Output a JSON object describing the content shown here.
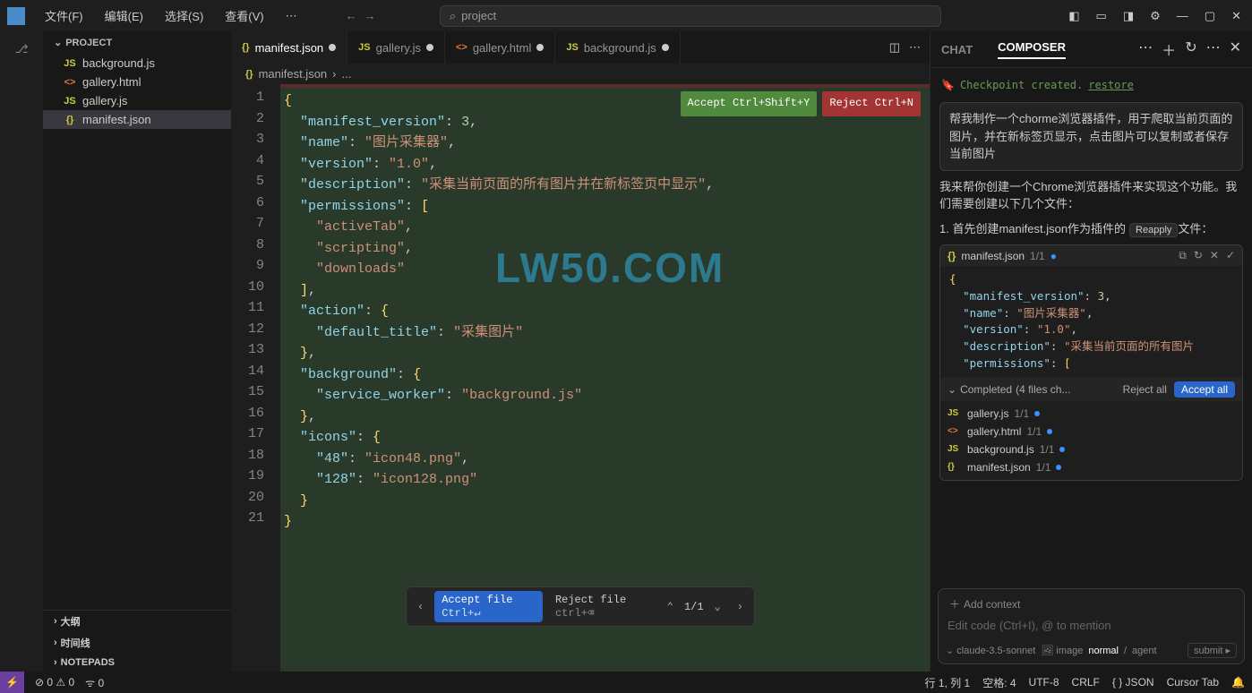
{
  "titlebar": {
    "menus": [
      "文件(F)",
      "编辑(E)",
      "选择(S)",
      "查看(V)",
      "⋯"
    ],
    "search_placeholder": "project"
  },
  "sidebar": {
    "header": "PROJECT",
    "files": [
      {
        "icon": "JS",
        "iconClass": "icon-js",
        "name": "background.js"
      },
      {
        "icon": "<>",
        "iconClass": "icon-html",
        "name": "gallery.html"
      },
      {
        "icon": "JS",
        "iconClass": "icon-js",
        "name": "gallery.js"
      },
      {
        "icon": "{}",
        "iconClass": "icon-json",
        "name": "manifest.json"
      }
    ],
    "selected_index": 3,
    "bottom_sections": [
      "大纲",
      "时间线",
      "NOTEPADS"
    ]
  },
  "tabs": [
    {
      "icon": "{}",
      "iconClass": "icon-json",
      "label": "manifest.json",
      "modified": true,
      "active": true
    },
    {
      "icon": "JS",
      "iconClass": "icon-js",
      "label": "gallery.js",
      "modified": true,
      "active": false
    },
    {
      "icon": "<>",
      "iconClass": "icon-html",
      "label": "gallery.html",
      "modified": true,
      "active": false
    },
    {
      "icon": "JS",
      "iconClass": "icon-js",
      "label": "background.js",
      "modified": true,
      "active": false
    }
  ],
  "breadcrumb": {
    "file": "manifest.json",
    "rest": "..."
  },
  "overlay": {
    "accept": "Accept Ctrl+Shift+Y",
    "reject": "Reject Ctrl+N"
  },
  "diffbar": {
    "accept": "Accept file",
    "accept_kbd": "Ctrl+↵",
    "reject": "Reject file",
    "reject_kbd": "ctrl+⌫",
    "pos": "1/1"
  },
  "watermark": "LW50.COM",
  "code_lines": [
    [
      {
        "t": "brace",
        "v": "{"
      }
    ],
    [
      {
        "t": "sp",
        "v": "  "
      },
      {
        "t": "key",
        "v": "\"manifest_version\""
      },
      {
        "t": "colon",
        "v": ": "
      },
      {
        "t": "num",
        "v": "3"
      },
      {
        "t": "punct",
        "v": ","
      }
    ],
    [
      {
        "t": "sp",
        "v": "  "
      },
      {
        "t": "key",
        "v": "\"name\""
      },
      {
        "t": "colon",
        "v": ": "
      },
      {
        "t": "str",
        "v": "\"图片采集器\""
      },
      {
        "t": "punct",
        "v": ","
      }
    ],
    [
      {
        "t": "sp",
        "v": "  "
      },
      {
        "t": "key",
        "v": "\"version\""
      },
      {
        "t": "colon",
        "v": ": "
      },
      {
        "t": "str",
        "v": "\"1.0\""
      },
      {
        "t": "punct",
        "v": ","
      }
    ],
    [
      {
        "t": "sp",
        "v": "  "
      },
      {
        "t": "key",
        "v": "\"description\""
      },
      {
        "t": "colon",
        "v": ": "
      },
      {
        "t": "str",
        "v": "\"采集当前页面的所有图片并在新标签页中显示\""
      },
      {
        "t": "punct",
        "v": ","
      }
    ],
    [
      {
        "t": "sp",
        "v": "  "
      },
      {
        "t": "key",
        "v": "\"permissions\""
      },
      {
        "t": "colon",
        "v": ": "
      },
      {
        "t": "brace",
        "v": "["
      }
    ],
    [
      {
        "t": "sp",
        "v": "    "
      },
      {
        "t": "str",
        "v": "\"activeTab\""
      },
      {
        "t": "punct",
        "v": ","
      }
    ],
    [
      {
        "t": "sp",
        "v": "    "
      },
      {
        "t": "str",
        "v": "\"scripting\""
      },
      {
        "t": "punct",
        "v": ","
      }
    ],
    [
      {
        "t": "sp",
        "v": "    "
      },
      {
        "t": "str",
        "v": "\"downloads\""
      }
    ],
    [
      {
        "t": "sp",
        "v": "  "
      },
      {
        "t": "brace",
        "v": "]"
      },
      {
        "t": "punct",
        "v": ","
      }
    ],
    [
      {
        "t": "sp",
        "v": "  "
      },
      {
        "t": "key",
        "v": "\"action\""
      },
      {
        "t": "colon",
        "v": ": "
      },
      {
        "t": "brace",
        "v": "{"
      }
    ],
    [
      {
        "t": "sp",
        "v": "    "
      },
      {
        "t": "key",
        "v": "\"default_title\""
      },
      {
        "t": "colon",
        "v": ": "
      },
      {
        "t": "str",
        "v": "\"采集图片\""
      }
    ],
    [
      {
        "t": "sp",
        "v": "  "
      },
      {
        "t": "brace",
        "v": "}"
      },
      {
        "t": "punct",
        "v": ","
      }
    ],
    [
      {
        "t": "sp",
        "v": "  "
      },
      {
        "t": "key",
        "v": "\"background\""
      },
      {
        "t": "colon",
        "v": ": "
      },
      {
        "t": "brace",
        "v": "{"
      }
    ],
    [
      {
        "t": "sp",
        "v": "    "
      },
      {
        "t": "key",
        "v": "\"service_worker\""
      },
      {
        "t": "colon",
        "v": ": "
      },
      {
        "t": "str",
        "v": "\"background.js\""
      }
    ],
    [
      {
        "t": "sp",
        "v": "  "
      },
      {
        "t": "brace",
        "v": "}"
      },
      {
        "t": "punct",
        "v": ","
      }
    ],
    [
      {
        "t": "sp",
        "v": "  "
      },
      {
        "t": "key",
        "v": "\"icons\""
      },
      {
        "t": "colon",
        "v": ": "
      },
      {
        "t": "brace",
        "v": "{"
      }
    ],
    [
      {
        "t": "sp",
        "v": "    "
      },
      {
        "t": "key",
        "v": "\"48\""
      },
      {
        "t": "colon",
        "v": ": "
      },
      {
        "t": "str",
        "v": "\"icon48.png\""
      },
      {
        "t": "punct",
        "v": ","
      }
    ],
    [
      {
        "t": "sp",
        "v": "    "
      },
      {
        "t": "key",
        "v": "\"128\""
      },
      {
        "t": "colon",
        "v": ": "
      },
      {
        "t": "str",
        "v": "\"icon128.png\""
      }
    ],
    [
      {
        "t": "sp",
        "v": "  "
      },
      {
        "t": "brace",
        "v": "}"
      }
    ],
    [
      {
        "t": "brace",
        "v": "}"
      }
    ]
  ],
  "chat": {
    "tabs": [
      "CHAT",
      "COMPOSER"
    ],
    "active_tab": 1,
    "checkpoint": "Checkpoint created.",
    "checkpoint_action": "restore",
    "user_message": "帮我制作一个chorme浏览器插件，用于爬取当前页面的图片，并在新标签页显示，点击图片可以复制或者保存当前图片",
    "assistant_intro": "我来帮你创建一个Chrome浏览器插件来实现这个功能。我们需要创建以下几个文件：",
    "assistant_step1": "1. 首先创建manifest.json作为插件的",
    "reapply": "Reapply",
    "step1_suffix": "文件：",
    "code_card": {
      "file": "manifest.json",
      "ratio": "1/1",
      "lines": [
        [
          {
            "t": "brace",
            "v": "{"
          }
        ],
        [
          {
            "t": "sp",
            "v": "  "
          },
          {
            "t": "key",
            "v": "\"manifest_version\""
          },
          {
            "t": "colon",
            "v": ": "
          },
          {
            "t": "num",
            "v": "3"
          },
          {
            "t": "punct",
            "v": ","
          }
        ],
        [
          {
            "t": "sp",
            "v": "  "
          },
          {
            "t": "key",
            "v": "\"name\""
          },
          {
            "t": "colon",
            "v": ": "
          },
          {
            "t": "str",
            "v": "\"图片采集器\""
          },
          {
            "t": "punct",
            "v": ","
          }
        ],
        [
          {
            "t": "sp",
            "v": "  "
          },
          {
            "t": "key",
            "v": "\"version\""
          },
          {
            "t": "colon",
            "v": ": "
          },
          {
            "t": "str",
            "v": "\"1.0\""
          },
          {
            "t": "punct",
            "v": ","
          }
        ],
        [
          {
            "t": "sp",
            "v": "  "
          },
          {
            "t": "key",
            "v": "\"description\""
          },
          {
            "t": "colon",
            "v": ": "
          },
          {
            "t": "str",
            "v": "\"采集当前页面的所有图片"
          }
        ],
        [
          {
            "t": "sp",
            "v": "  "
          },
          {
            "t": "key",
            "v": "\"permissions\""
          },
          {
            "t": "colon",
            "v": ": "
          },
          {
            "t": "brace",
            "v": "["
          }
        ]
      ]
    },
    "completed": {
      "label": "Completed",
      "detail": "(4 files ch...",
      "reject": "Reject all",
      "accept": "Accept all"
    },
    "file_changes": [
      {
        "icon": "JS",
        "iconClass": "icon-js",
        "name": "gallery.js",
        "ratio": "1/1"
      },
      {
        "icon": "<>",
        "iconClass": "icon-html",
        "name": "gallery.html",
        "ratio": "1/1"
      },
      {
        "icon": "JS",
        "iconClass": "icon-js",
        "name": "background.js",
        "ratio": "1/1"
      },
      {
        "icon": "{}",
        "iconClass": "icon-json",
        "name": "manifest.json",
        "ratio": "1/1"
      }
    ],
    "add_context": "Add context",
    "input_placeholder": "Edit code (Ctrl+I), @ to mention",
    "footer": {
      "model": "claude-3.5-sonnet",
      "image": "image",
      "mode": "normal",
      "agent": "agent",
      "submit": "submit"
    }
  },
  "status": {
    "errors": "0",
    "warnings": "0",
    "ports": "0",
    "line_col": "行 1, 列 1",
    "spaces": "空格: 4",
    "encoding": "UTF-8",
    "eol": "CRLF",
    "lang": "{ } JSON",
    "cursor": "Cursor Tab"
  }
}
